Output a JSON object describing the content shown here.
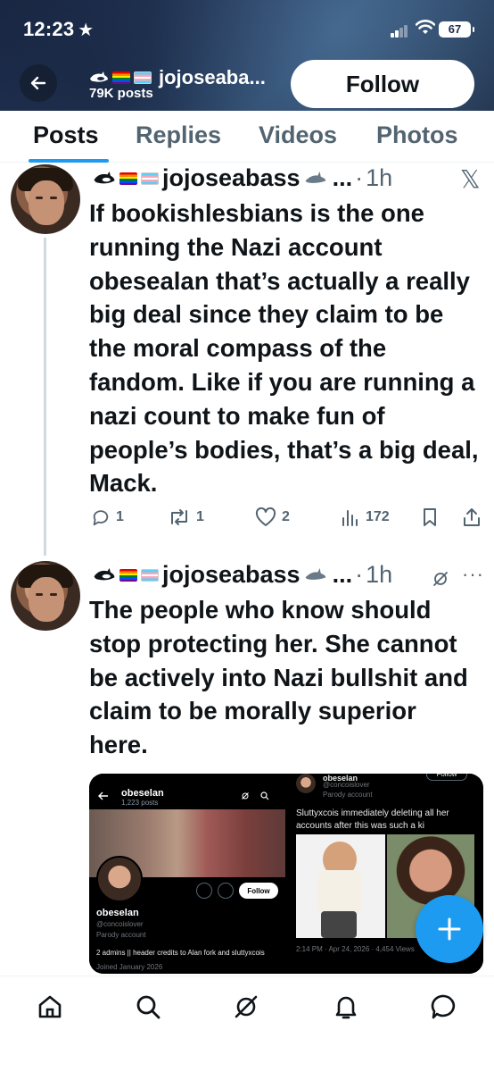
{
  "status_bar": {
    "time": "12:23",
    "battery": "67"
  },
  "header": {
    "name": "jojoseaba...",
    "posts_count": "79K posts",
    "follow_label": "Follow"
  },
  "tabs": [
    {
      "label": "Posts",
      "active": true
    },
    {
      "label": "Replies",
      "active": false
    },
    {
      "label": "Videos",
      "active": false
    },
    {
      "label": "Photos",
      "active": false
    }
  ],
  "posts": [
    {
      "display_name": "jojoseabass",
      "truncation": "...",
      "separator": "·",
      "time": "1h",
      "text": "If bookishlesbians is the one running the Nazi account obesealan that’s actually a really big deal since they claim to be the moral compass of the fandom. Like if you are running a nazi count to make fun of people’s bodies, that’s a big deal, Mack.",
      "replies": "1",
      "reposts": "1",
      "likes": "2",
      "views": "172"
    },
    {
      "display_name": "jojoseabass",
      "truncation": "...",
      "separator": "·",
      "time": "1h",
      "text": "The people who know should stop protecting her. She cannot be actively into Nazi bullshit and claim to be morally superior here.",
      "media": {
        "left": {
          "title": "obeselan",
          "subtitle": "1,223 posts",
          "follow": "Follow",
          "name": "obeselan",
          "handle": "@concoislover",
          "parody": "Parody account",
          "bio": "2 admins || header credits to Alan fork and sluttyxcois",
          "joined": "Joined January 2026"
        },
        "right": {
          "name": "obeselan",
          "handle": "@concoislover",
          "parody": "Parody account",
          "follow": "Follow",
          "text": "Sluttyxcois immediately deleting all her accounts after this was such a ki",
          "meta": "2:14 PM · Apr 24, 2026 · 4,454 Views"
        }
      }
    }
  ],
  "colors": {
    "accent": "#1d9bf0",
    "text": "#0f1419",
    "secondary": "#536471"
  }
}
